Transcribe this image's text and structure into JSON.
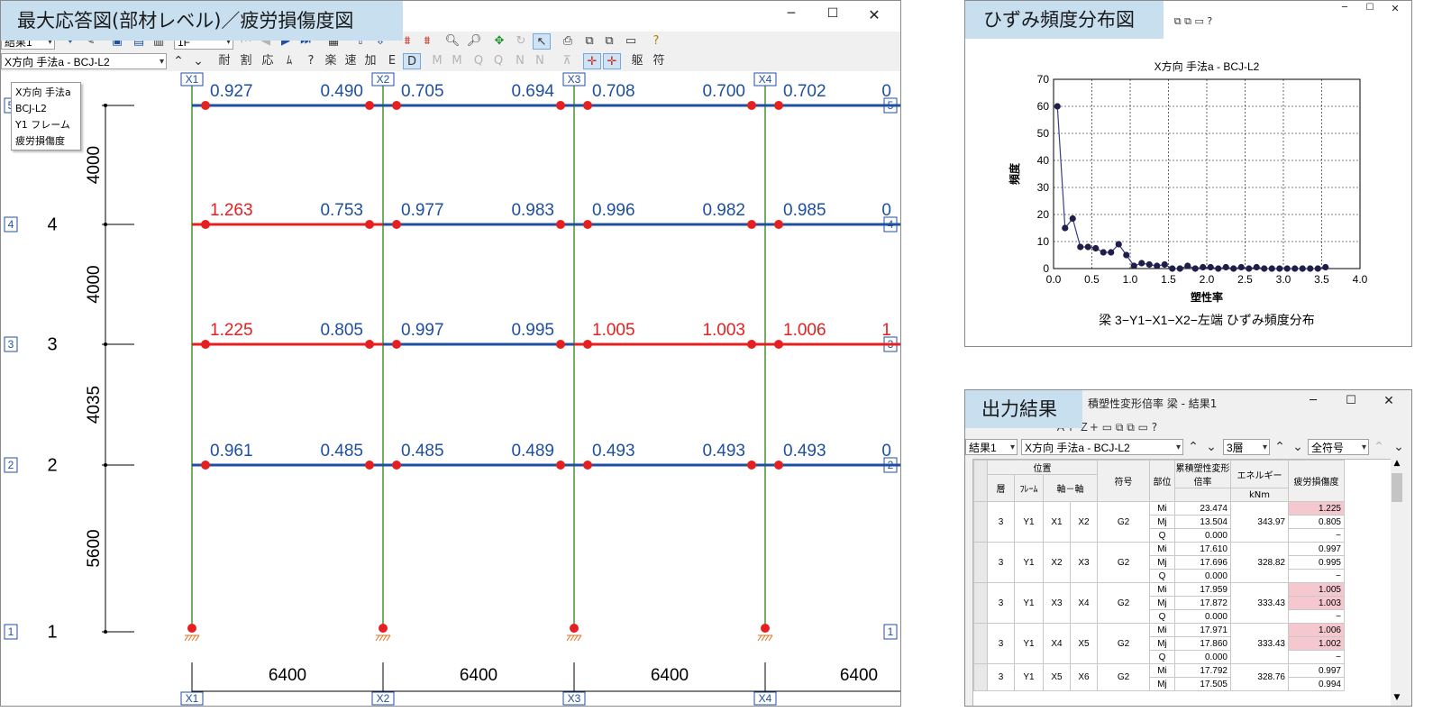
{
  "colors": {
    "blue_beam": "#1f4fa0",
    "red_beam": "#e62020",
    "column": "#3a8a20",
    "title_bg": "#c8dff0",
    "pink": "#f5c8d0",
    "chart_line": "#3c3c8a"
  },
  "win1": {
    "title": "最大応答図(部材レベル)／疲労損傷度図",
    "controls": [
      "─",
      "☐",
      "✕"
    ],
    "toolbar1": {
      "result_select": "結果1",
      "combo2": "1F"
    },
    "toolbar2": {
      "case_select": "X方向 手法a - BCJ-L2",
      "buttons": [
        "耐",
        "割",
        "応",
        "ﾑ",
        "?",
        "楽",
        "速",
        "加",
        "E",
        "D",
        "M",
        "M",
        "Q",
        "Q",
        "N",
        "N"
      ],
      "last": [
        "躯",
        "符"
      ]
    },
    "legend": [
      "X方向 手法a",
      "BCJ-L2",
      "Y1 フレーム",
      "疲労損傷度"
    ],
    "axes_top": [
      "X1",
      "X2",
      "X3",
      "X4"
    ],
    "axes_bottom": [
      "X1",
      "X2",
      "X3",
      "X4"
    ],
    "floor_tags": [
      "5",
      "4",
      "3",
      "2",
      "1"
    ],
    "floor_labels": [
      "4",
      "3",
      "2",
      "1"
    ],
    "heights": [
      "4000",
      "4000",
      "4035",
      "5600"
    ],
    "spans": [
      "6400",
      "6400",
      "6400",
      "6400"
    ],
    "beam_values": [
      {
        "floor": "5",
        "values": [
          {
            "v": "0.927",
            "c": "blue"
          },
          {
            "v": "0.490",
            "c": "blue"
          },
          {
            "v": "0.705",
            "c": "blue"
          },
          {
            "v": "0.694",
            "c": "blue"
          },
          {
            "v": "0.708",
            "c": "blue"
          },
          {
            "v": "0.700",
            "c": "blue"
          },
          {
            "v": "0.702",
            "c": "blue"
          },
          {
            "v": "0",
            "c": "blue"
          }
        ],
        "line": [
          "blue",
          "blue",
          "blue",
          "blue"
        ]
      },
      {
        "floor": "4",
        "values": [
          {
            "v": "1.263",
            "c": "red"
          },
          {
            "v": "0.753",
            "c": "blue"
          },
          {
            "v": "0.977",
            "c": "blue"
          },
          {
            "v": "0.983",
            "c": "blue"
          },
          {
            "v": "0.996",
            "c": "blue"
          },
          {
            "v": "0.982",
            "c": "blue"
          },
          {
            "v": "0.985",
            "c": "blue"
          },
          {
            "v": "0",
            "c": "blue"
          }
        ],
        "line": [
          "red",
          "blue",
          "blue",
          "blue"
        ]
      },
      {
        "floor": "3",
        "values": [
          {
            "v": "1.225",
            "c": "red"
          },
          {
            "v": "0.805",
            "c": "blue"
          },
          {
            "v": "0.997",
            "c": "blue"
          },
          {
            "v": "0.995",
            "c": "blue"
          },
          {
            "v": "1.005",
            "c": "red"
          },
          {
            "v": "1.003",
            "c": "red"
          },
          {
            "v": "1.006",
            "c": "red"
          },
          {
            "v": "1",
            "c": "red"
          }
        ],
        "line": [
          "red",
          "blue",
          "red",
          "red"
        ]
      },
      {
        "floor": "2",
        "values": [
          {
            "v": "0.961",
            "c": "blue"
          },
          {
            "v": "0.485",
            "c": "blue"
          },
          {
            "v": "0.485",
            "c": "blue"
          },
          {
            "v": "0.489",
            "c": "blue"
          },
          {
            "v": "0.493",
            "c": "blue"
          },
          {
            "v": "0.493",
            "c": "blue"
          },
          {
            "v": "0.493",
            "c": "blue"
          },
          {
            "v": "0",
            "c": "blue"
          }
        ],
        "line": [
          "blue",
          "blue",
          "blue",
          "blue"
        ]
      }
    ]
  },
  "win2": {
    "title": "ひずみ頻度分布図",
    "controls": [
      "─",
      "☐",
      "✕"
    ],
    "chart_title": "X方向 手法a - BCJ-L2",
    "caption": "梁 3−Y1−X1−X2−左端 ひずみ頻度分布",
    "chart_data": {
      "type": "line",
      "title": "X方向 手法a - BCJ-L2",
      "xlabel": "塑性率",
      "ylabel": "頻度",
      "xlim": [
        0,
        4
      ],
      "ylim": [
        0,
        70
      ],
      "xticks": [
        "0.0",
        "0.5",
        "1.0",
        "1.5",
        "2.0",
        "2.5",
        "3.0",
        "3.5",
        "4.0"
      ],
      "yticks": [
        "0",
        "10",
        "20",
        "30",
        "40",
        "50",
        "60",
        "70"
      ],
      "grid": true,
      "x": [
        0.05,
        0.15,
        0.25,
        0.35,
        0.45,
        0.55,
        0.65,
        0.75,
        0.85,
        0.95,
        1.05,
        1.15,
        1.25,
        1.35,
        1.45,
        1.55,
        1.65,
        1.75,
        1.85,
        1.95,
        2.05,
        2.15,
        2.25,
        2.35,
        2.45,
        2.55,
        2.65,
        2.75,
        2.85,
        2.95,
        3.05,
        3.15,
        3.25,
        3.35,
        3.45,
        3.55
      ],
      "y": [
        60,
        15,
        18.5,
        8,
        8,
        7.5,
        6,
        6,
        9,
        5,
        1,
        2,
        1.5,
        1,
        1.5,
        0,
        0,
        1,
        0,
        0.5,
        0.5,
        0,
        0.5,
        0,
        0.5,
        0,
        0.5,
        0,
        0,
        0,
        0,
        0,
        0,
        0,
        0,
        0.5
      ]
    }
  },
  "win3": {
    "title": "出力結果",
    "subtitle": "積塑性変形倍率 梁 - 結果1",
    "controls": [
      "─",
      "☐",
      "✕"
    ],
    "selects": {
      "result": "結果1",
      "case": "X方向 手法a - BCJ-L2",
      "floor": "3層",
      "sign": "全符号"
    },
    "headers": {
      "position": "位置",
      "floor": "層",
      "frame": "ﾌﾚｰﾑ",
      "axis": "軸－軸",
      "symbol": "符号",
      "part": "部位",
      "ratio": "累積塑性変形倍率",
      "energy": "エネルギー",
      "energy_unit": "kNm",
      "damage": "疲労損傷度"
    },
    "rows": [
      {
        "floor": "3",
        "frame": "Y1",
        "a1": "X1",
        "a2": "X2",
        "sym": "G2",
        "parts": [
          "Mi",
          "Mj",
          "Q"
        ],
        "ratio": [
          "23.474",
          "13.504",
          "0.000"
        ],
        "energy": "343.97",
        "damage": [
          "1.225",
          "0.805",
          "−"
        ],
        "pink": [
          true,
          false,
          false
        ]
      },
      {
        "floor": "3",
        "frame": "Y1",
        "a1": "X2",
        "a2": "X3",
        "sym": "G2",
        "parts": [
          "Mi",
          "Mj",
          "Q"
        ],
        "ratio": [
          "17.610",
          "17.696",
          "0.000"
        ],
        "energy": "328.82",
        "damage": [
          "0.997",
          "0.995",
          "−"
        ],
        "pink": [
          false,
          false,
          false
        ]
      },
      {
        "floor": "3",
        "frame": "Y1",
        "a1": "X3",
        "a2": "X4",
        "sym": "G2",
        "parts": [
          "Mi",
          "Mj",
          "Q"
        ],
        "ratio": [
          "17.959",
          "17.872",
          "0.000"
        ],
        "energy": "333.43",
        "damage": [
          "1.005",
          "1.003",
          "−"
        ],
        "pink": [
          true,
          true,
          false
        ]
      },
      {
        "floor": "3",
        "frame": "Y1",
        "a1": "X4",
        "a2": "X5",
        "sym": "G2",
        "parts": [
          "Mi",
          "Mj",
          "Q"
        ],
        "ratio": [
          "17.971",
          "17.860",
          "0.000"
        ],
        "energy": "333.43",
        "damage": [
          "1.006",
          "1.002",
          "−"
        ],
        "pink": [
          true,
          true,
          false
        ]
      },
      {
        "floor": "3",
        "frame": "Y1",
        "a1": "X5",
        "a2": "X6",
        "sym": "G2",
        "parts": [
          "Mi",
          "Mj"
        ],
        "ratio": [
          "17.792",
          "17.505"
        ],
        "energy": "328.76",
        "damage": [
          "0.997",
          "0.994"
        ],
        "pink": [
          false,
          false
        ]
      }
    ]
  }
}
